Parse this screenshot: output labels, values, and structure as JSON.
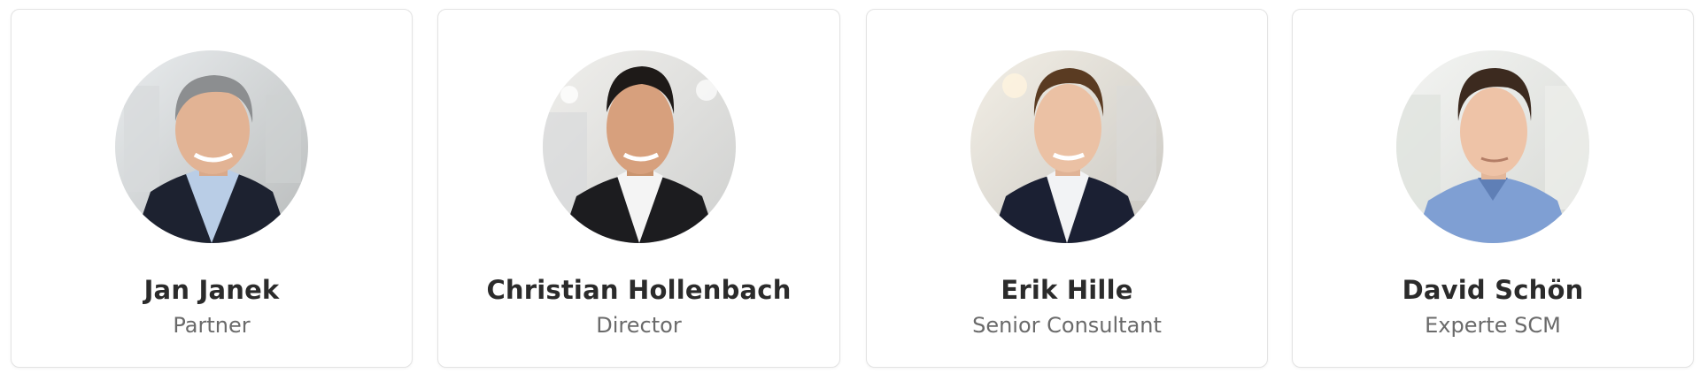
{
  "team": [
    {
      "name": "Jan Janek",
      "role": "Partner",
      "photo": "portrait-photo"
    },
    {
      "name": "Christian Hollenbach",
      "role": "Director",
      "photo": "portrait-photo"
    },
    {
      "name": "Erik Hille",
      "role": "Senior Consultant",
      "photo": "portrait-photo"
    },
    {
      "name": "David Schön",
      "role": "Experte SCM",
      "photo": "portrait-photo"
    }
  ],
  "colors": {
    "card_border": "#e3e3e3",
    "name_text": "#2b2b2b",
    "role_text": "#6a6a6a"
  }
}
